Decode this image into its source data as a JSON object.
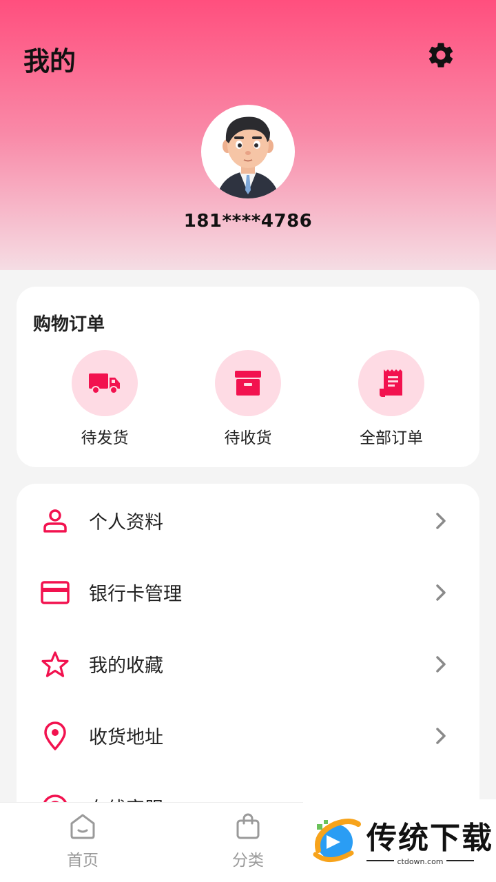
{
  "header": {
    "title": "我的",
    "settings_icon": "gear-icon",
    "avatar": "user-avatar-cartoon-man",
    "phone": "181****4786"
  },
  "orders": {
    "title": "购物订单",
    "items": [
      {
        "label": "待发货",
        "icon": "truck-icon"
      },
      {
        "label": "待收货",
        "icon": "archive-box-icon"
      },
      {
        "label": "全部订单",
        "icon": "receipt-icon"
      }
    ]
  },
  "menu": {
    "items": [
      {
        "label": "个人资料",
        "icon": "user-icon"
      },
      {
        "label": "银行卡管理",
        "icon": "credit-card-icon"
      },
      {
        "label": "我的收藏",
        "icon": "star-icon"
      },
      {
        "label": "收货地址",
        "icon": "location-pin-icon"
      },
      {
        "label": "在线客服",
        "icon": "support-icon"
      }
    ]
  },
  "tabbar": {
    "tabs": [
      {
        "label": "首页",
        "icon": "home-icon"
      },
      {
        "label": "分类",
        "icon": "bag-icon"
      }
    ]
  },
  "watermark": {
    "text": "传统下载",
    "sub": "ctdown.com"
  },
  "colors": {
    "accent": "#f2124f",
    "header_top": "#ff4f7e",
    "icon_bg": "#fedbe4"
  }
}
